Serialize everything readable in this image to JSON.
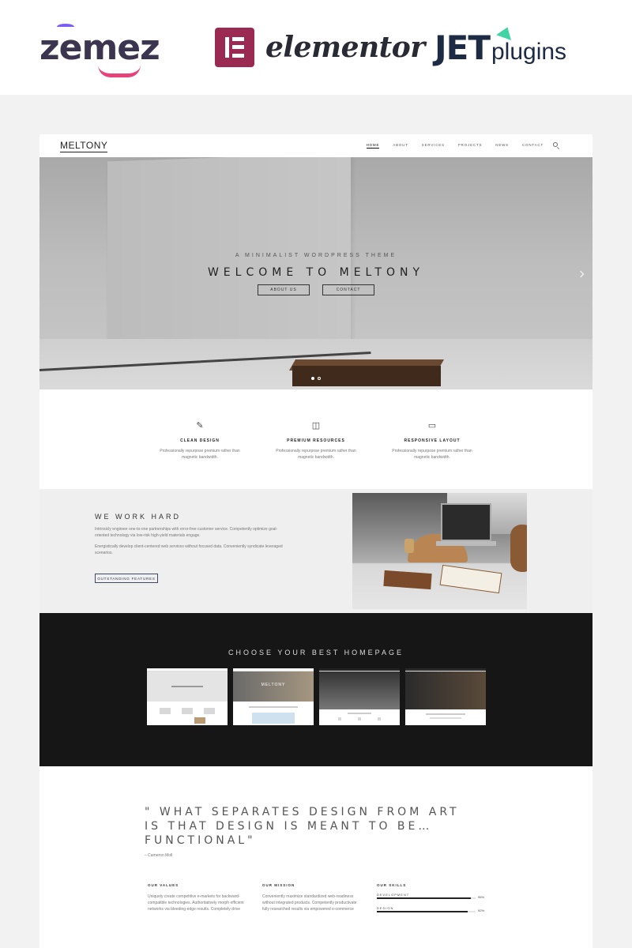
{
  "brands": {
    "zemes": "zemez",
    "elementor": "elementor",
    "jet": "JET",
    "jet_suffix": "plugins"
  },
  "site": {
    "logo": "MELTONY",
    "nav": [
      "HOME",
      "ABOUT",
      "SERVICES",
      "PROJECTS",
      "NEWS",
      "CONTACT"
    ],
    "hero": {
      "tagline": "A MINIMALIST WORDPRESS THEME",
      "title": "WELCOME TO MELTONY",
      "btn_about": "ABOUT US",
      "btn_contact": "CONTACT"
    },
    "features": [
      {
        "icon": "pencil-ruler-icon",
        "title": "CLEAN DESIGN",
        "text": "Professionally repurpose premium rather than magnetic bandwidth."
      },
      {
        "icon": "gift-icon",
        "title": "PREMIUM RESOURCES",
        "text": "Professionally repurpose premium rather than magnetic bandwidth."
      },
      {
        "icon": "laptop-icon",
        "title": "RESPONSIVE LAYOUT",
        "text": "Professionally repurpose premium rather than magnetic bandwidth."
      }
    ],
    "work": {
      "title": "WE WORK HARD",
      "p1": "Intrinsicly engineer one-to-one partnerships with error-free customer service. Competently optimize goal-oriented technology via low-risk high-yield materials engage.",
      "p2": "Energistically develop client-centered web services without focused data. Conveniently syndicate leveraged scenarios.",
      "button": "OUTSTANDING FEATURES"
    },
    "homepages": {
      "title": "CHOOSE YOUR BEST HOMEPAGE",
      "thumb2_title": "MELTONY"
    },
    "quote": {
      "text": "\" WHAT SEPARATES DESIGN FROM ART IS THAT DESIGN IS MEANT TO BE… FUNCTIONAL\"",
      "author": "– Cameron Moll"
    },
    "values": {
      "title": "OUR VALUES",
      "text": "Uniquely create competitive e-markets for backward-compatible technologies. Authoritatively morph efficient networks via bleeding-edge results. Completely drive"
    },
    "mission": {
      "title": "OUR MISSION",
      "text": "Conveniently maximize standardized web-readiness without integrated products. Competently productivate fully researched results via empowered e-commerce"
    },
    "skills": {
      "title": "OUR SKILLS",
      "items": [
        {
          "label": "DEVELOPMENT",
          "value": "95%",
          "fraction": 0.95
        },
        {
          "label": "DESIGN",
          "value": "92%",
          "fraction": 0.92
        }
      ]
    }
  }
}
